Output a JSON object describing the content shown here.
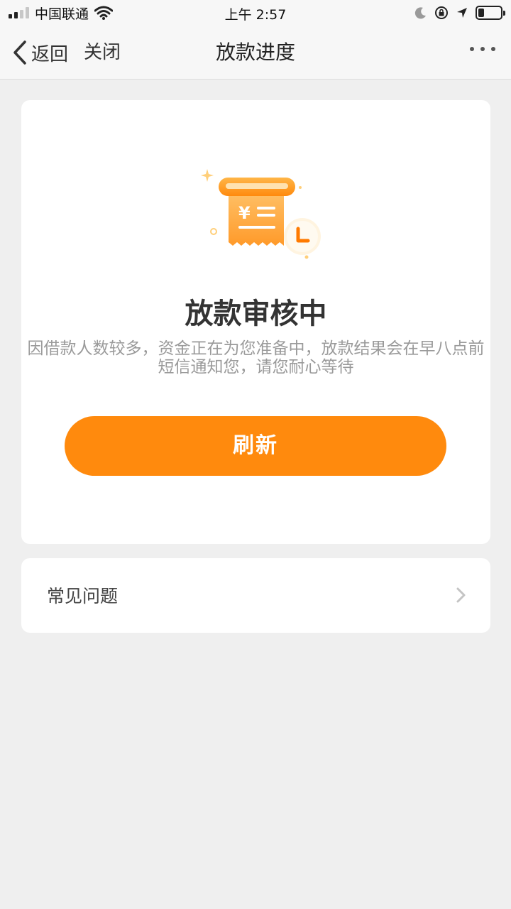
{
  "status_bar": {
    "carrier": "中国联通",
    "time": "上午 2:57"
  },
  "nav": {
    "back_label": "返回",
    "close_label": "关闭",
    "title": "放款进度"
  },
  "main": {
    "status_title": "放款审核中",
    "status_desc": "因借款人数较多，资金正在为您准备中，放款结果会在早八点前短信通知您，请您耐心等待",
    "refresh_label": "刷新",
    "illustration_symbol": "¥"
  },
  "faq": {
    "label": "常见问题"
  },
  "colors": {
    "accent": "#ff8a0d",
    "background": "#efefef",
    "card": "#ffffff"
  },
  "icons": [
    "signal-icon",
    "wifi-icon",
    "moon-icon",
    "orientation-lock-icon",
    "location-icon",
    "battery-icon",
    "back-chevron-icon",
    "more-icon",
    "receipt-clock-icon",
    "chevron-right-icon"
  ]
}
